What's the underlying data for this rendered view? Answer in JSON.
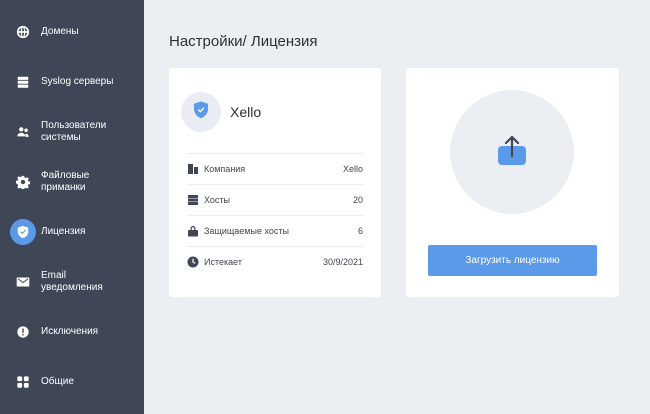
{
  "sidebar": {
    "items": [
      {
        "label": "Домены",
        "icon": "globe-icon"
      },
      {
        "label": "Syslog серверы",
        "icon": "server-icon"
      },
      {
        "label": "Пользователи системы",
        "icon": "users-icon"
      },
      {
        "label": "Файловые приманки",
        "icon": "gear-icon"
      },
      {
        "label": "Лицензия",
        "icon": "shield-icon",
        "active": true
      },
      {
        "label": "Email уведомления",
        "icon": "mail-icon"
      },
      {
        "label": "Исключения",
        "icon": "exclamation-icon"
      },
      {
        "label": "Общие",
        "icon": "grid-icon"
      }
    ]
  },
  "page": {
    "title": "Настройки/ Лицензия"
  },
  "license": {
    "name": "Xello",
    "rows": [
      {
        "label": "Компания",
        "value": "Xello",
        "icon": "building-icon"
      },
      {
        "label": "Хосты",
        "value": "20",
        "icon": "hosts-icon"
      },
      {
        "label": "Защищаемые хосты",
        "value": "6",
        "icon": "lock-icon"
      },
      {
        "label": "Истекает",
        "value": "30/9/2021",
        "icon": "clock-icon"
      }
    ]
  },
  "upload": {
    "button_label": "Загрузить лицензию",
    "icon": "upload-icon"
  },
  "colors": {
    "sidebar_bg": "#3f4656",
    "accent": "#5b9ae8",
    "page_bg": "#ebeef3"
  }
}
